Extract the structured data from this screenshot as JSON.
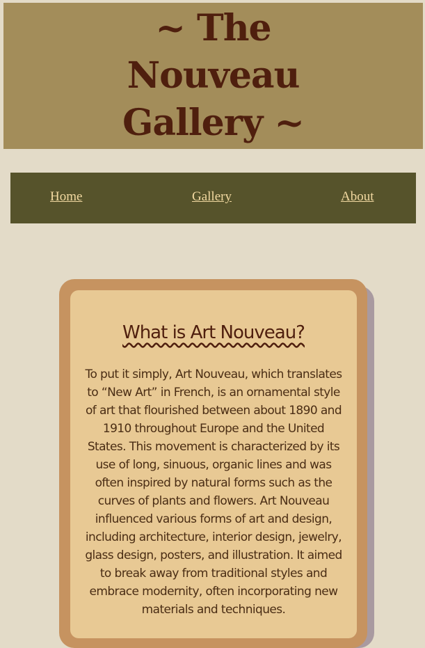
{
  "header": {
    "title": "~ The Nouveau Gallery ~"
  },
  "nav": {
    "items": [
      {
        "label": "Home"
      },
      {
        "label": "Gallery"
      },
      {
        "label": "About"
      }
    ]
  },
  "card": {
    "heading": "What is Art Nouveau?",
    "body": "To put it simply, Art Nouveau, which translates to “New Art” in French, is an ornamental style of art that flourished between about 1890 and 1910 throughout Europe and the United States. This movement is characterized by its use of long, sinuous, organic lines and was often inspired by natural forms such as the curves of plants and flowers. Art Nouveau influenced various forms of art and design, including architecture, interior design, jewelry, glass design, posters, and illustration. It aimed to break away from traditional styles and embrace modernity, often incorporating new materials and techniques."
  },
  "colors": {
    "page_background": "#e3dbc8",
    "header_background": "#a38d5a",
    "title_color": "#4f1f0e",
    "nav_background": "#56532b",
    "nav_link": "#f2d9a1",
    "card_frame": "#c69360",
    "card_background": "#e8c994",
    "card_shadow": "#a99aa0"
  }
}
